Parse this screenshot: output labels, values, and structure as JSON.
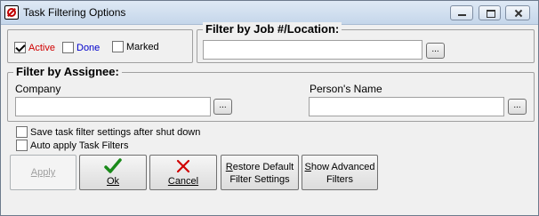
{
  "window": {
    "title": "Task Filtering Options"
  },
  "status_filters": [
    {
      "label": "Active",
      "checked": true,
      "color": "#d00000"
    },
    {
      "label": "Done",
      "checked": false,
      "color": "#0000cc"
    },
    {
      "label": "Marked",
      "checked": false,
      "color": "#000000"
    }
  ],
  "job_filter": {
    "title": "Filter by Job #/Location:",
    "value": "",
    "browse_label": "..."
  },
  "assignee_filter": {
    "title": "Filter by Assignee:",
    "company_label": "Company",
    "company_value": "",
    "person_label": "Person's Name",
    "person_value": "",
    "browse_label": "..."
  },
  "options": [
    {
      "label": "Save task filter settings after shut down",
      "checked": false
    },
    {
      "label": "Auto apply Task Filters",
      "checked": false
    }
  ],
  "buttons": {
    "apply": "Apply",
    "ok": "Ok",
    "cancel": "Cancel",
    "restore_line1": "Restore Default",
    "restore_line2": "Filter Settings",
    "advanced_line1": "Show Advanced",
    "advanced_line2": "Filters"
  },
  "icons": {
    "ok": "checkmark-icon",
    "cancel": "x-icon",
    "ok_color": "#1a8a1a",
    "cancel_color": "#d00000"
  }
}
